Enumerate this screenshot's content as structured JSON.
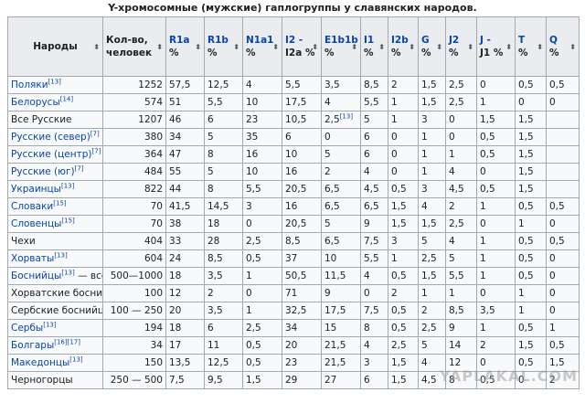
{
  "caption": "Y-хромосомные (мужские) гаплогруппы у славянских народов.",
  "headers": [
    {
      "l1": "Народы",
      "l2": "",
      "link": false
    },
    {
      "l1": "Кол-во,",
      "l2": "человек",
      "link": false
    },
    {
      "l1": "R1a",
      "l2": "%",
      "link": true
    },
    {
      "l1": "R1b",
      "l2": "%",
      "link": true
    },
    {
      "l1": "N1a1",
      "l2": "%",
      "link": true
    },
    {
      "l1": "I2 -",
      "l2": "I2a %",
      "link": true
    },
    {
      "l1": "E1b1b",
      "l2": "%",
      "link": true
    },
    {
      "l1": "I1",
      "l2": "%",
      "link": true
    },
    {
      "l1": "I2b",
      "l2": "%",
      "link": true
    },
    {
      "l1": "G",
      "l2": "%",
      "link": true
    },
    {
      "l1": "J2",
      "l2": "%",
      "link": true
    },
    {
      "l1": "J -",
      "l2": "J1 %",
      "link": true
    },
    {
      "l1": "T",
      "l2": "%",
      "link": true
    },
    {
      "l1": "Q",
      "l2": "%",
      "link": true
    }
  ],
  "sort_glyph": "⬍",
  "rows": [
    {
      "name": "Поляки",
      "ref": "[13]",
      "link": true,
      "suffix": "",
      "cells": [
        "1252",
        "57,5",
        "12,5",
        "4",
        "5,5",
        "3,5",
        "8,5",
        "2",
        "1,5",
        "2,5",
        "0",
        "0,5",
        "0,5"
      ]
    },
    {
      "name": "Белорусы",
      "ref": "[14]",
      "link": true,
      "suffix": "",
      "cells": [
        "574",
        "51",
        "5,5",
        "10",
        "17,5",
        "4",
        "5,5",
        "1",
        "1,5",
        "2,5",
        "1",
        "0",
        "0"
      ]
    },
    {
      "name": "Все Русские",
      "ref": "",
      "link": false,
      "suffix": "",
      "cells": [
        "1207",
        "46",
        "6",
        "23",
        "10,5",
        "2,5[13]",
        "5",
        "1",
        "3",
        "0",
        "1,5",
        "1,5"
      ]
    },
    {
      "name": "Русские (север)",
      "ref": "[7]",
      "link": true,
      "suffix": "",
      "cells": [
        "380",
        "34",
        "5",
        "35",
        "6",
        "0",
        "6",
        "0",
        "1",
        "0",
        "0,5",
        "1,5"
      ]
    },
    {
      "name": "Русские (центр)",
      "ref": "[7]",
      "link": true,
      "suffix": "",
      "cells": [
        "364",
        "47",
        "8",
        "16",
        "10",
        "5",
        "6",
        "0",
        "1",
        "1",
        "0,5",
        "1,5"
      ]
    },
    {
      "name": "Русские (юг)",
      "ref": "[7]",
      "link": true,
      "suffix": "",
      "cells": [
        "484",
        "55",
        "5",
        "10",
        "16",
        "2",
        "4",
        "0",
        "1",
        "4",
        "0",
        "1,5"
      ]
    },
    {
      "name": "Украинцы",
      "ref": "[13]",
      "link": true,
      "suffix": "",
      "cells": [
        "822",
        "44",
        "8",
        "5,5",
        "20,5",
        "6,5",
        "4,5",
        "0,5",
        "3",
        "4,5",
        "0,5",
        "1,5"
      ]
    },
    {
      "name": "Словаки",
      "ref": "[15]",
      "link": true,
      "suffix": "",
      "cells": [
        "70",
        "41,5",
        "14,5",
        "3",
        "16",
        "6,5",
        "6,5",
        "1,5",
        "4",
        "2",
        "1",
        "0,5",
        "0,5"
      ]
    },
    {
      "name": "Словенцы",
      "ref": "[15]",
      "link": true,
      "suffix": "",
      "cells": [
        "70",
        "38",
        "18",
        "0",
        "20,5",
        "5",
        "9",
        "1,5",
        "1,5",
        "2,5",
        "0",
        "1",
        "0"
      ]
    },
    {
      "name": "Чехи",
      "ref": "",
      "link": false,
      "suffix": "",
      "cells": [
        "404",
        "33",
        "28",
        "2,5",
        "8,5",
        "6,5",
        "7,5",
        "3",
        "5",
        "4",
        "1",
        "0,5",
        "0,5"
      ]
    },
    {
      "name": "Хорваты",
      "ref": "[13]",
      "link": true,
      "suffix": "",
      "cells": [
        "604",
        "24",
        "8,5",
        "0,5",
        "37",
        "10",
        "5,5",
        "1",
        "2,5",
        "5",
        "1",
        "0,5",
        "0"
      ]
    },
    {
      "name": "Боснийцы",
      "ref": "[13]",
      "link": true,
      "suffix": " — все",
      "cells": [
        "500—1000",
        "18",
        "3,5",
        "1",
        "50,5",
        "11,5",
        "4",
        "0,5",
        "1,5",
        "5,5",
        "1",
        "0,5",
        "0"
      ]
    },
    {
      "name": "Хорватские боснийцы",
      "ref": "",
      "link": false,
      "suffix": "",
      "cells": [
        "100",
        "12",
        "2",
        "0",
        "71",
        "9",
        "0",
        "2",
        "1",
        "1",
        "0",
        "1",
        "0"
      ]
    },
    {
      "name": "Сербские боснийцы",
      "ref": "",
      "link": false,
      "suffix": "",
      "cells": [
        "100 — 250",
        "20",
        "3,5",
        "1",
        "32,5",
        "17,5",
        "7,5",
        "0,5",
        "2",
        "8,5",
        "3,5",
        "1",
        "0"
      ]
    },
    {
      "name": "Сербы",
      "ref": "[13]",
      "link": true,
      "suffix": "",
      "cells": [
        "194",
        "18",
        "6",
        "2,5",
        "34",
        "15",
        "8",
        "0,5",
        "2,5",
        "9",
        "1",
        "0,5",
        "1"
      ]
    },
    {
      "name": "Болгары",
      "ref": "[16][17]",
      "link": true,
      "suffix": "",
      "cells": [
        "34",
        "17",
        "11",
        "0,5",
        "20",
        "21,5",
        "4",
        "2,5",
        "5",
        "14",
        "2",
        "1,5",
        "0,5"
      ]
    },
    {
      "name": "Македонцы",
      "ref": "[13]",
      "link": true,
      "suffix": "",
      "cells": [
        "150",
        "13,5",
        "12,5",
        "0,5",
        "23",
        "21,5",
        "3",
        "1,5",
        "4",
        "12",
        "0",
        "0,5",
        "1,5"
      ]
    },
    {
      "name": "Черногорцы",
      "ref": "",
      "link": false,
      "suffix": "",
      "cells": [
        "250 — 500",
        "7,5",
        "9,5",
        "1,5",
        "29",
        "27",
        "6",
        "1,5",
        "4,5",
        "8",
        "0,5",
        "0",
        "2"
      ]
    }
  ],
  "watermark": "YAPLAKAL.COM"
}
